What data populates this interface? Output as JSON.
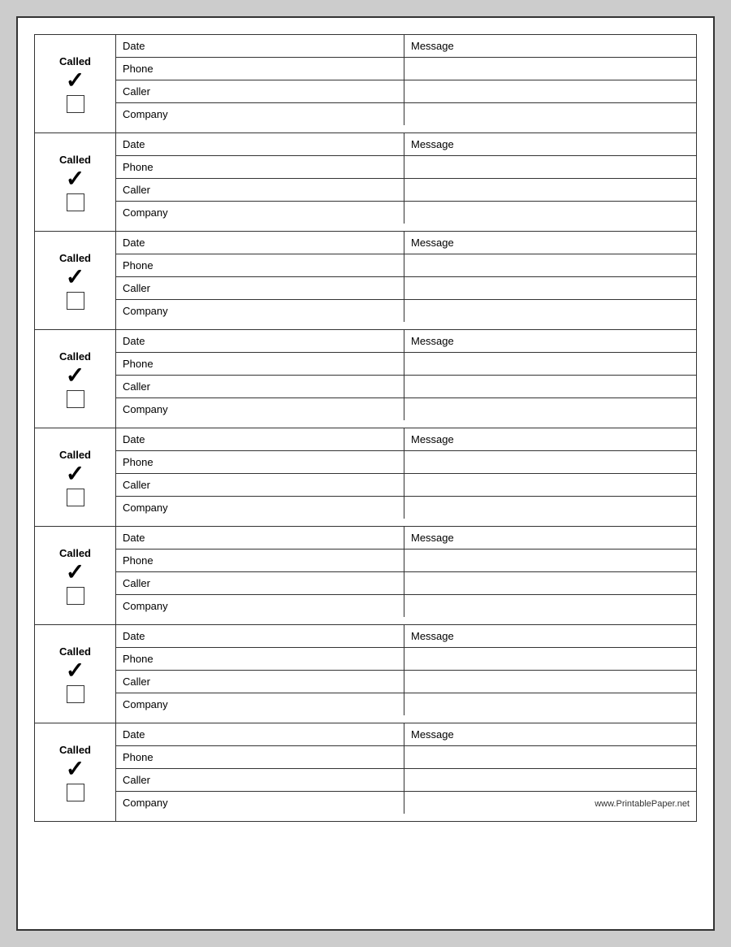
{
  "records": [
    {
      "called_label": "Called",
      "checkmark": "✓",
      "date_label": "Date",
      "message_label": "Message",
      "phone_label": "Phone",
      "caller_label": "Caller",
      "company_label": "Company",
      "watermark": ""
    },
    {
      "called_label": "Called",
      "checkmark": "✓",
      "date_label": "Date",
      "message_label": "Message",
      "phone_label": "Phone",
      "caller_label": "Caller",
      "company_label": "Company",
      "watermark": ""
    },
    {
      "called_label": "Called",
      "checkmark": "✓",
      "date_label": "Date",
      "message_label": "Message",
      "phone_label": "Phone",
      "caller_label": "Caller",
      "company_label": "Company",
      "watermark": ""
    },
    {
      "called_label": "Called",
      "checkmark": "✓",
      "date_label": "Date",
      "message_label": "Message",
      "phone_label": "Phone",
      "caller_label": "Caller",
      "company_label": "Company",
      "watermark": ""
    },
    {
      "called_label": "Called",
      "checkmark": "✓",
      "date_label": "Date",
      "message_label": "Message",
      "phone_label": "Phone",
      "caller_label": "Caller",
      "company_label": "Company",
      "watermark": ""
    },
    {
      "called_label": "Called",
      "checkmark": "✓",
      "date_label": "Date",
      "message_label": "Message",
      "phone_label": "Phone",
      "caller_label": "Caller",
      "company_label": "Company",
      "watermark": ""
    },
    {
      "called_label": "Called",
      "checkmark": "✓",
      "date_label": "Date",
      "message_label": "Message",
      "phone_label": "Phone",
      "caller_label": "Caller",
      "company_label": "Company",
      "watermark": ""
    },
    {
      "called_label": "Called",
      "checkmark": "✓",
      "date_label": "Date",
      "message_label": "Message",
      "phone_label": "Phone",
      "caller_label": "Caller",
      "company_label": "Company",
      "watermark": "www.PrintablePaper.net"
    }
  ]
}
